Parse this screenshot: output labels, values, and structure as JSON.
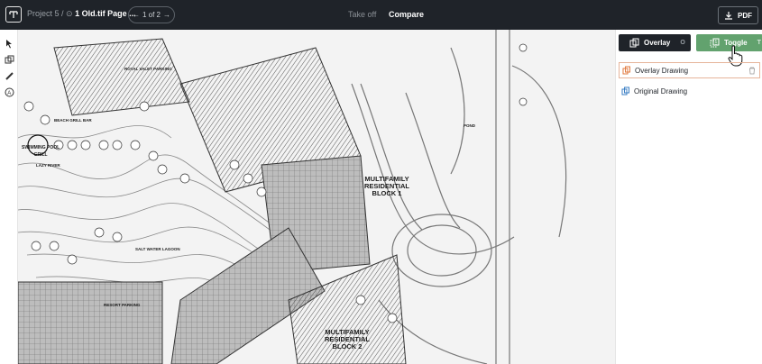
{
  "header": {
    "project": "Project 5 /",
    "file": "1 Old.tif Page ...",
    "pager": "1 of 2",
    "tabs": {
      "takeoff": "Take off",
      "compare": "Compare"
    },
    "pdf_label": "PDF"
  },
  "panel": {
    "overlay_button": "Overlay",
    "overlay_shortcut": "O",
    "toggle_button": "Toggle",
    "toggle_shortcut": "T",
    "layers": [
      "Overlay Drawing",
      "Original Drawing"
    ]
  },
  "drawing_labels": {
    "block1": "MULTIFAMILY\nRESIDENTIAL\nBLOCK 1",
    "block2": "MULTIFAMILY\nRESIDENTIAL\nBLOCK 2",
    "pool": "SWIMMING POOL\nGRILL",
    "lazy_river": "LAZY RIVER",
    "beach_grill": "BEACH GRILL BAR",
    "saltwater": "SALT WATER LAGOON",
    "resort_parking": "RESORT PARKING",
    "valet_parking": "ROYAL VALET PARKING",
    "pond": "POND"
  },
  "colors": {
    "topbar": "#1f2329",
    "toggle": "#62a26e",
    "overlay_border": "#e6b49a"
  }
}
